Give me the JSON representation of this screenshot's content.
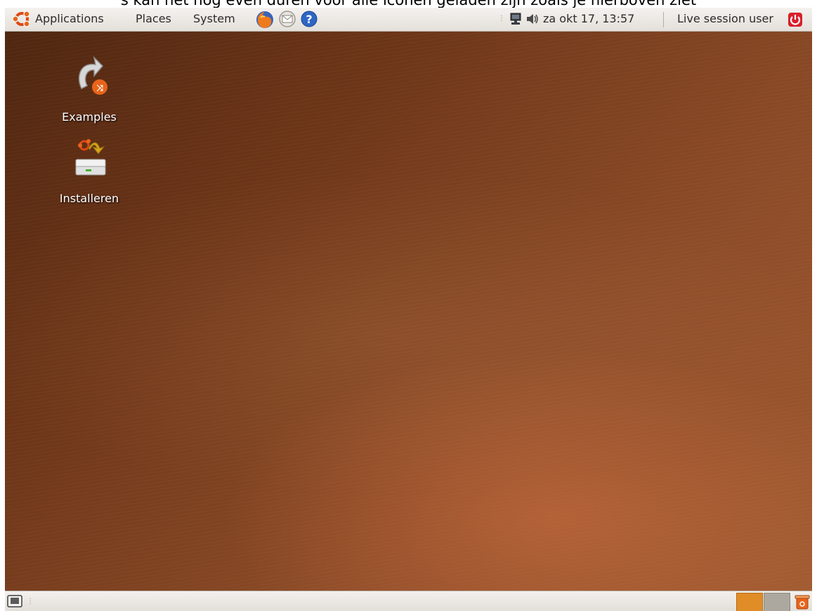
{
  "caption": "s kan het nog even duren voor alle iconen geladen zijn zoals je hierboven ziet",
  "top_panel": {
    "menus": [
      {
        "label": "Applications"
      },
      {
        "label": "Places"
      },
      {
        "label": "System"
      }
    ],
    "launchers": [
      "firefox-icon",
      "mail-icon",
      "help-icon"
    ],
    "tray_icons": [
      "network-icon",
      "volume-icon"
    ],
    "clock": "za okt 17, 13:57",
    "user": "Live session user",
    "power_icon": "power-icon"
  },
  "desktop": {
    "icons": [
      {
        "label": "Examples",
        "icon": "examples-icon"
      },
      {
        "label": "Installeren",
        "icon": "installer-icon"
      }
    ]
  },
  "bottom_panel": {
    "show_desktop_icon": "show-desktop-icon",
    "workspaces": 2,
    "active_workspace": 1,
    "trash_icon": "trash-icon"
  },
  "colors": {
    "panel": "#ece9e4",
    "desktop": "#7a3c1c",
    "workspace_active": "#e08d28",
    "workspace_inactive": "#ada89f",
    "power": "#d8202b",
    "ubuntu_logo": "#dd4814"
  }
}
